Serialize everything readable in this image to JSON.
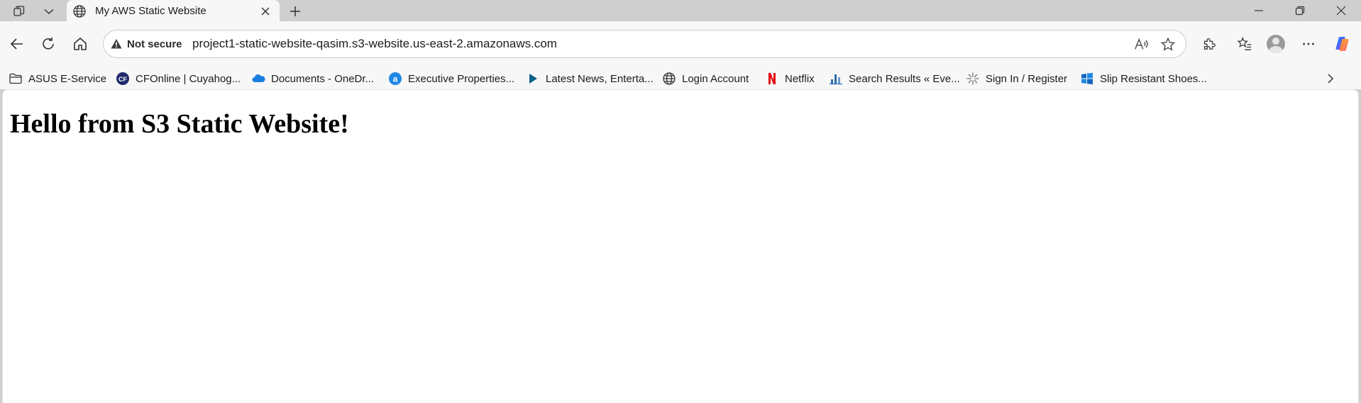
{
  "browser": {
    "tab": {
      "title": "My AWS Static Website"
    },
    "address_bar": {
      "security_label": "Not secure",
      "url": "project1-static-website-qasim.s3-website.us-east-2.amazonaws.com"
    },
    "bookmarks": [
      {
        "label": "ASUS E-Service",
        "icon": "folder-icon"
      },
      {
        "label": "CFOnline | Cuyahog...",
        "icon": "cfonline-icon"
      },
      {
        "label": "Documents - OneDr...",
        "icon": "onedrive-cloud-icon"
      },
      {
        "label": "Executive Properties...",
        "icon": "executive-properties-icon"
      },
      {
        "label": "Latest News, Enterta...",
        "icon": "play-triangle-icon"
      },
      {
        "label": "Login Account",
        "icon": "globe-icon"
      },
      {
        "label": "Netflix",
        "icon": "netflix-icon"
      },
      {
        "label": "Search Results « Eve...",
        "icon": "chart-bars-icon"
      },
      {
        "label": "Sign In / Register",
        "icon": "sparkle-icon"
      },
      {
        "label": "Slip Resistant Shoes...",
        "icon": "windows-logo-icon"
      }
    ]
  },
  "page": {
    "heading": "Hello from S3 Static Website!"
  },
  "colors": {
    "chrome_bg": "#cfcfcf",
    "toolbar_bg": "#f7f7f7",
    "page_bg": "#ffffff",
    "netflix_red": "#e50914",
    "cf_navy": "#1f2a6b",
    "onedrive_blue": "#1a7ee0"
  }
}
